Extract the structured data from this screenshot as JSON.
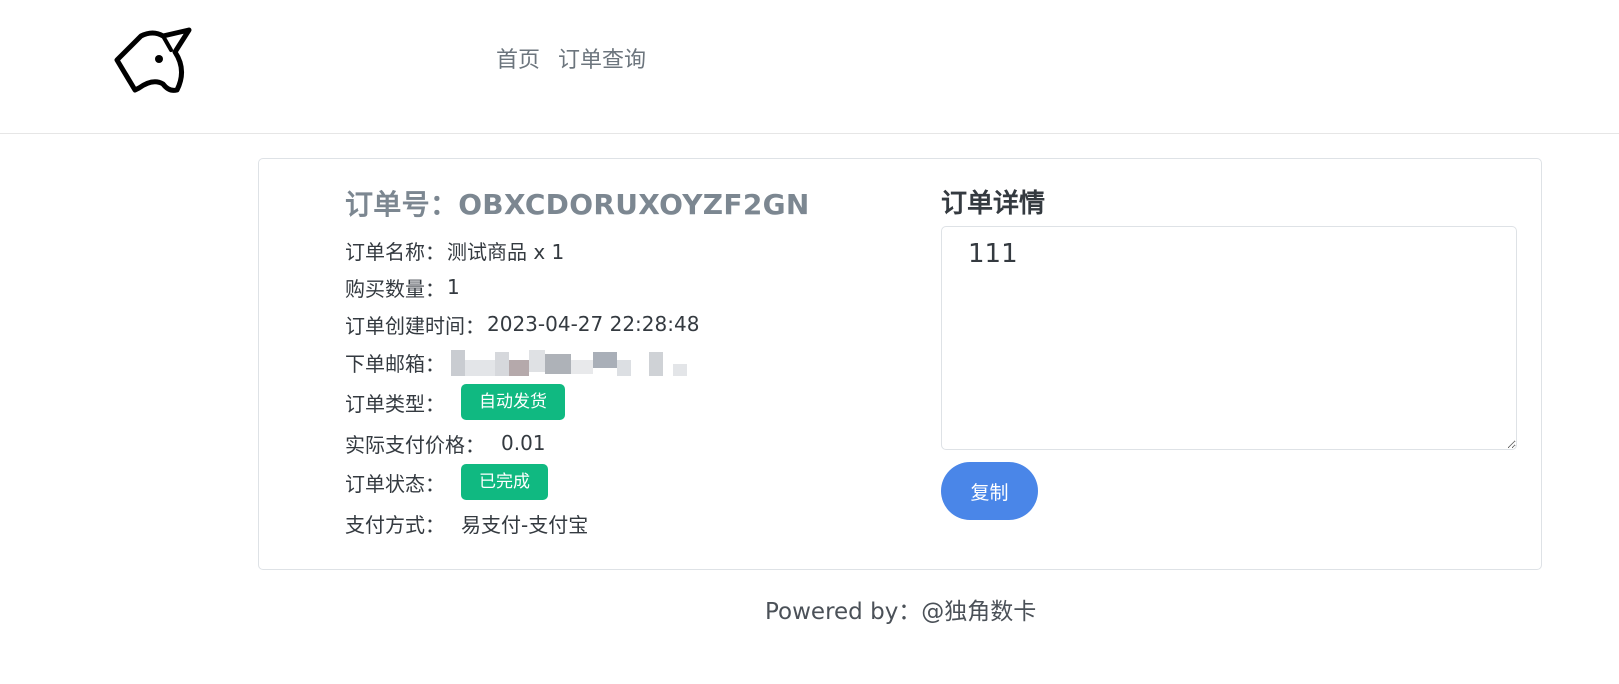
{
  "nav": {
    "logo_icon": "unicorn-icon",
    "links": [
      "首页",
      "订单查询"
    ]
  },
  "order": {
    "title": "订单号：OBXCDORUXOYZF2GN",
    "name_label": "订单名称：",
    "name_value": "测试商品 x 1",
    "qty_label": "购买数量：",
    "qty_value": "1",
    "created_label": "订单创建时间：",
    "created_value": "2023-04-27 22:28:48",
    "email_label": "下单邮箱：",
    "type_label": "订单类型：",
    "type_badge": "自动发货",
    "price_label": "实际支付价格：",
    "price_value": "0.01",
    "status_label": "订单状态：",
    "status_badge": "已完成",
    "payment_label": "支付方式：",
    "payment_value": "易支付-支付宝"
  },
  "detail": {
    "title": "订单详情",
    "content": "111",
    "copy_label": "复制"
  },
  "footer": {
    "text": "Powered by：@独角数卡"
  },
  "colors": {
    "badge_green": "#10b981",
    "copy_blue": "#4a86e8",
    "order_title_gray": "#7c8791"
  }
}
